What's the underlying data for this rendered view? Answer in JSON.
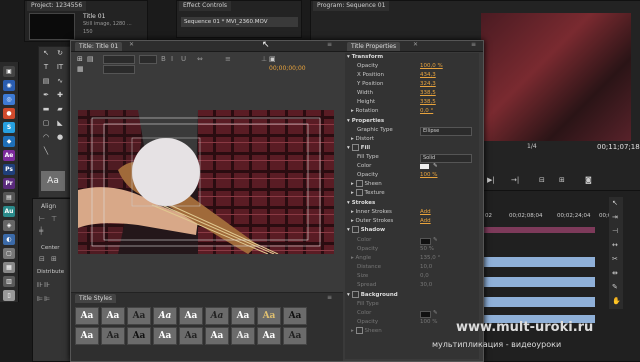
{
  "project_panel": {
    "tab": "Project: 1234556",
    "clip_name": "Title 01",
    "clip_info": "Still image, 1280 ...",
    "clip_info2": "150"
  },
  "effect_controls": {
    "tab": "Effect Controls",
    "sequence": "Sequence 01 * MVI_2360.MOV"
  },
  "program_monitor": {
    "tab": "Program: Sequence 01",
    "timecode": "00;11;07;18",
    "zoom": "1/4"
  },
  "titler": {
    "tab": "Title: Title 01",
    "timecode": "00;00;00;00",
    "properties": {
      "tab": "Title Properties",
      "transform_label": "Transform",
      "opacity_label": "Opacity",
      "opacity_value": "100,0 %",
      "xpos_label": "X Position",
      "xpos_value": "434,3",
      "ypos_label": "Y Position",
      "ypos_value": "324,3",
      "width_label": "Width",
      "width_value": "338,5",
      "height_label": "Height",
      "height_value": "338,5",
      "rotation_label": "Rotation",
      "rotation_value": "0,0 °",
      "properties_label": "Properties",
      "graphic_type_label": "Graphic Type",
      "graphic_type_value": "Ellipse",
      "distort_label": "Distort",
      "fill_label": "Fill",
      "fill_type_label": "Fill Type",
      "fill_type_value": "Solid",
      "color_label": "Color",
      "fill_opacity_label": "Opacity",
      "fill_opacity_value": "100 %",
      "sheen_label": "Sheen",
      "texture_label": "Texture",
      "strokes_label": "Strokes",
      "inner_strokes_label": "Inner Strokes",
      "inner_strokes_value": "Add",
      "outer_strokes_label": "Outer Strokes",
      "outer_strokes_value": "Add",
      "shadow_label": "Shadow",
      "shadow_color_label": "Color",
      "shadow_opacity_label": "Opacity",
      "shadow_opacity_value": "50 %",
      "angle_label": "Angle",
      "angle_value": "135,0 °",
      "distance_label": "Distance",
      "distance_value": "10,0",
      "size_label": "Size",
      "size_value": "0,0",
      "spread_label": "Spread",
      "spread_value": "30,0",
      "background_label": "Background",
      "bg_fill_type_label": "Fill Type",
      "bg_color_label": "Color",
      "bg_opacity_label": "Opacity",
      "bg_opacity_value": "100 %",
      "bg_sheen_label": "Sheen"
    },
    "align_label": "Align",
    "center_label": "Center",
    "distribute_label": "Distribute",
    "styles_tab": "Title Styles",
    "style_sample": "Aa"
  },
  "timeline": {
    "time_a": "02",
    "time_b": "00;02;08;04",
    "time_c": "00;02;24;04",
    "time_d": "00;0"
  },
  "watermark": {
    "url": "www.mult-uroki.ru",
    "subtitle": "мультипликация - видеоуроки"
  },
  "colors": {
    "accent": "#e8a33d",
    "panel": "#3a3a3a",
    "timeline_clip": "#8fb0d8"
  }
}
